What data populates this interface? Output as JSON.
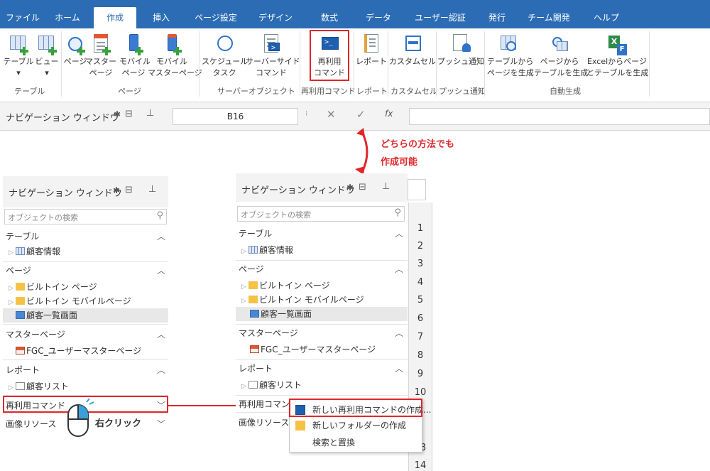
{
  "tabs": [
    "ファイル",
    "ホーム",
    "作成",
    "挿入",
    "ページ設定",
    "デザイン",
    "数式",
    "データ",
    "ユーザー認証",
    "発行",
    "チーム開発",
    "ヘルプ"
  ],
  "ribbon": {
    "buttons": [
      {
        "line1": "テーブル",
        "line2": "▾",
        "icon": "table-add-icon"
      },
      {
        "line1": "ビュー",
        "line2": "▾",
        "icon": "view-add-icon"
      },
      {
        "line1": "ページ",
        "line2": "",
        "icon": "page-globe-icon"
      },
      {
        "line1": "マスター",
        "line2": "ページ",
        "icon": "master-page-icon"
      },
      {
        "line1": "モバイル",
        "line2": "ページ",
        "icon": "mobile-page-icon"
      },
      {
        "line1": "モバイル",
        "line2": "マスターページ",
        "icon": "mobile-master-page-icon"
      },
      {
        "line1": "スケジュール",
        "line2": "タスク",
        "icon": "schedule-clock-icon"
      },
      {
        "line1": "サーバーサイド",
        "line2": "コマンド",
        "icon": "server-command-icon"
      },
      {
        "line1": "再利用",
        "line2": "コマンド",
        "icon": "reusable-command-icon"
      },
      {
        "line1": "レポート",
        "line2": "",
        "icon": "report-icon"
      },
      {
        "line1": "カスタムセル",
        "line2": "",
        "icon": "custom-cell-icon"
      },
      {
        "line1": "プッシュ通知",
        "line2": "",
        "icon": "push-notification-icon"
      },
      {
        "line1": "テーブルから",
        "line2": "ページを生成",
        "icon": "table-to-page-icon"
      },
      {
        "line1": "ページから",
        "line2": "テーブルを生成",
        "icon": "page-to-table-icon"
      },
      {
        "line1": "Excelからページ",
        "line2": "とテーブルを生成",
        "icon": "excel-generate-icon"
      }
    ],
    "groups": [
      "テーブル",
      "ページ",
      "サーバーオブジェクト",
      "再利用コマンド",
      "レポート",
      "カスタムセル",
      "プッシュ通知",
      "自動生成"
    ]
  },
  "formula_bar": {
    "nav_title": "ナビゲーション ウィンドウ",
    "cell_ref": "B16",
    "fx": "fx"
  },
  "annotation": {
    "line1": "どちらの方法でも",
    "line2": "作成可能"
  },
  "nav": {
    "title": "ナビゲーション ウィンドウ",
    "search_placeholder": "オブジェクトの検索",
    "sections": {
      "table": "テーブル",
      "page": "ページ",
      "master": "マスターページ",
      "report": "レポート",
      "reusable": "再利用コマンド",
      "reusable_cut": "再利用コマン",
      "image": "画像リソース"
    },
    "items": {
      "customer_info": "顧客情報",
      "builtin_page": "ビルトイン ページ",
      "builtin_mobile": "ビルトイン モバイルページ",
      "customer_list_screen": "顧客一覧画面",
      "master_page": "FGC_ユーザーマスターページ",
      "customer_list": "顧客リスト"
    }
  },
  "right_click_label": "右クリック",
  "row_numbers": [
    "1",
    "2",
    "3",
    "4",
    "5",
    "6",
    "7",
    "8",
    "9",
    "10",
    "",
    "2",
    "13",
    "14"
  ],
  "context_menu": [
    "新しい再利用コマンドの作成...",
    "新しいフォルダーの作成",
    "検索と置換"
  ],
  "colors": {
    "ribbon_blue": "#2b6cb4",
    "highlight_red": "#e0262a"
  }
}
